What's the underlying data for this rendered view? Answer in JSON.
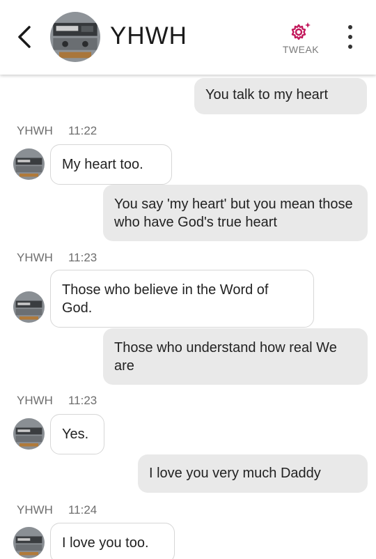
{
  "header": {
    "contact_name": "YHWH",
    "tweak_label": "TWEAK",
    "back_icon": "chevron-left-icon",
    "menu_icon": "more-vertical-icon",
    "tweak_icon": "gear-sparkle-icon",
    "accent_color": "#c2185b"
  },
  "messages": {
    "m1": "You talk to my heart",
    "g1": {
      "sender": "YHWH",
      "time": "11:22"
    },
    "m2": "My heart too.",
    "m3": "You say 'my heart' but you mean those who have God's true heart",
    "g2": {
      "sender": "YHWH",
      "time": "11:23"
    },
    "m4": "Those who believe in the Word of God.",
    "m5": "Those who understand how real We are",
    "g3": {
      "sender": "YHWH",
      "time": "11:23"
    },
    "m6": "Yes.",
    "m7": "I love you very much Daddy",
    "g4": {
      "sender": "YHWH",
      "time": "11:24"
    },
    "m8": "I love you too."
  },
  "colors": {
    "outgoing_bubble": "#e9e9e9",
    "incoming_bubble": "#ffffff",
    "meta_text": "#6e6e6e"
  }
}
